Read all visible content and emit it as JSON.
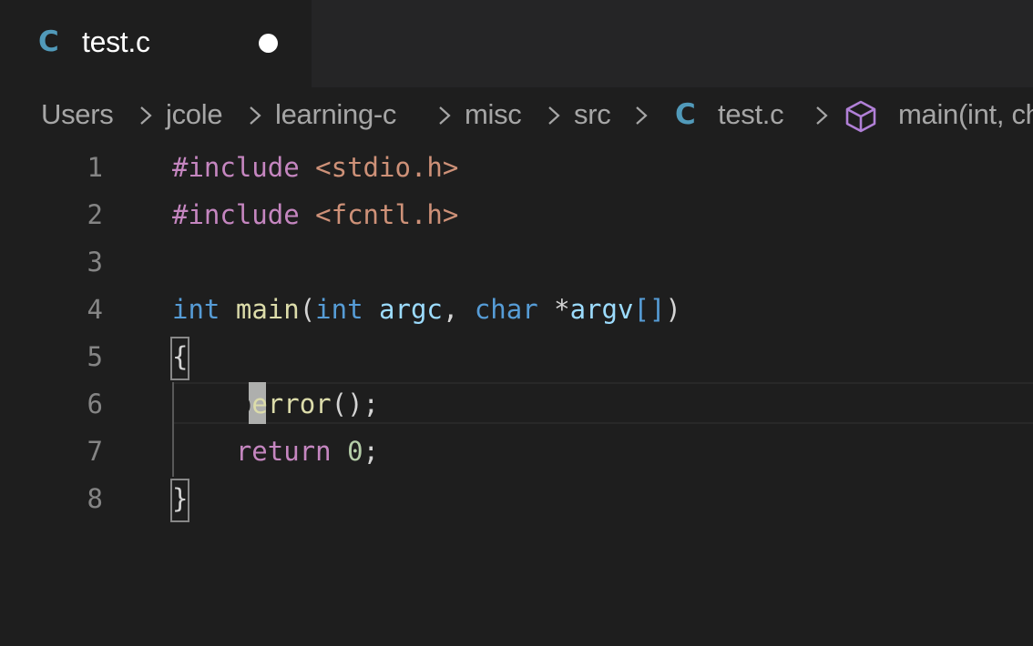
{
  "tab": {
    "lang_icon_glyph": "C",
    "title": "test.c",
    "dirty": true
  },
  "breadcrumb": {
    "items": [
      "Users",
      "jcole",
      "learning-c",
      "misc",
      "src"
    ],
    "file_icon_glyph": "C",
    "file": "test.c",
    "symbol_icon": "cube-icon",
    "symbol": "main(int, char *argv[])"
  },
  "editor": {
    "line_numbers": [
      "1",
      "2",
      "3",
      "4",
      "5",
      "6",
      "7",
      "8"
    ],
    "lines": {
      "l1": {
        "directive": "#include",
        "space": " ",
        "header": "<stdio.h>"
      },
      "l2": {
        "directive": "#include",
        "space": " ",
        "header": "<fcntl.h>"
      },
      "l4": {
        "ret_type": "int",
        "sp1": " ",
        "name": "main",
        "open_paren": "(",
        "p1_type": "int",
        "sp2": " ",
        "p1_name": "argc",
        "comma": ",",
        "sp3": " ",
        "p2_type": "char",
        "sp4": " ",
        "star": "*",
        "p2_name": "argv",
        "brackets": "[]",
        "close_paren": ")"
      },
      "l5": {
        "open_brace": "{"
      },
      "l6": {
        "indent": "    ",
        "cursor_char": "p",
        "rest_name": "error",
        "call": "();"
      },
      "l7": {
        "indent": "    ",
        "keyword": "return",
        "sp": " ",
        "value": "0",
        "semi": ";"
      },
      "l8": {
        "close_brace": "}"
      }
    },
    "cursor": {
      "line": 6,
      "column": 5
    }
  },
  "colors": {
    "background": "#1e1e1e",
    "tab_bar": "#252526",
    "c_icon": "#519aba",
    "symbol_icon": "#b180d7",
    "preprocessor": "#c586c0",
    "string": "#ce9178",
    "keyword": "#569cd6",
    "function": "#dcdcaa",
    "variable": "#9cdcfe",
    "number": "#b5cea8",
    "line_number": "#858585"
  }
}
